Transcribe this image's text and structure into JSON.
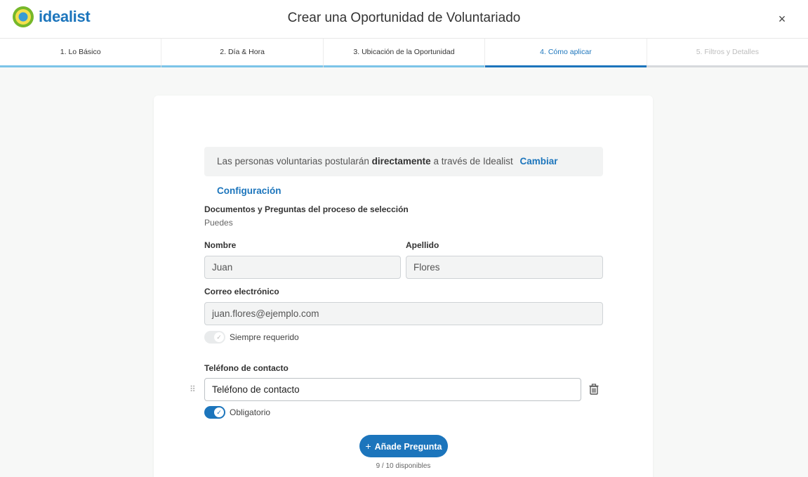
{
  "header": {
    "logo_text": "idealist",
    "title": "Crear una Oportunidad de Voluntariado",
    "close_icon": "×"
  },
  "steps": [
    {
      "label": "1. Lo Básico",
      "state": "done"
    },
    {
      "label": "2. Día & Hora",
      "state": "done"
    },
    {
      "label": "3. Ubicación de la Oportunidad",
      "state": "done"
    },
    {
      "label": "4. Cómo aplicar",
      "state": "active"
    },
    {
      "label": "5. Filtros y Detalles",
      "state": "future"
    }
  ],
  "notice": {
    "prefix": "Las personas voluntarias postularán ",
    "bold": "directamente",
    "suffix": " a través de Idealist",
    "link": "Cambiar Configuración"
  },
  "section": {
    "title": "Documentos y Preguntas del proceso de selección",
    "subtitle": "Puedes"
  },
  "fields": {
    "first_name": {
      "label": "Nombre",
      "value": "Juan"
    },
    "last_name": {
      "label": "Apellido",
      "value": "Flores"
    },
    "email": {
      "label": "Correo electrónico",
      "value": "juan.flores@ejemplo.com"
    },
    "email_toggle_label": "Siempre requerido",
    "phone": {
      "label": "Teléfono de contacto",
      "value": "Teléfono de contacto"
    },
    "phone_toggle_label": "Obligatorio"
  },
  "actions": {
    "add_question": "Añade Pregunta",
    "counter": "9 / 10 disponibles"
  },
  "colors": {
    "brand_blue": "#1c75bc",
    "progress_done": "#7cc4e8"
  }
}
